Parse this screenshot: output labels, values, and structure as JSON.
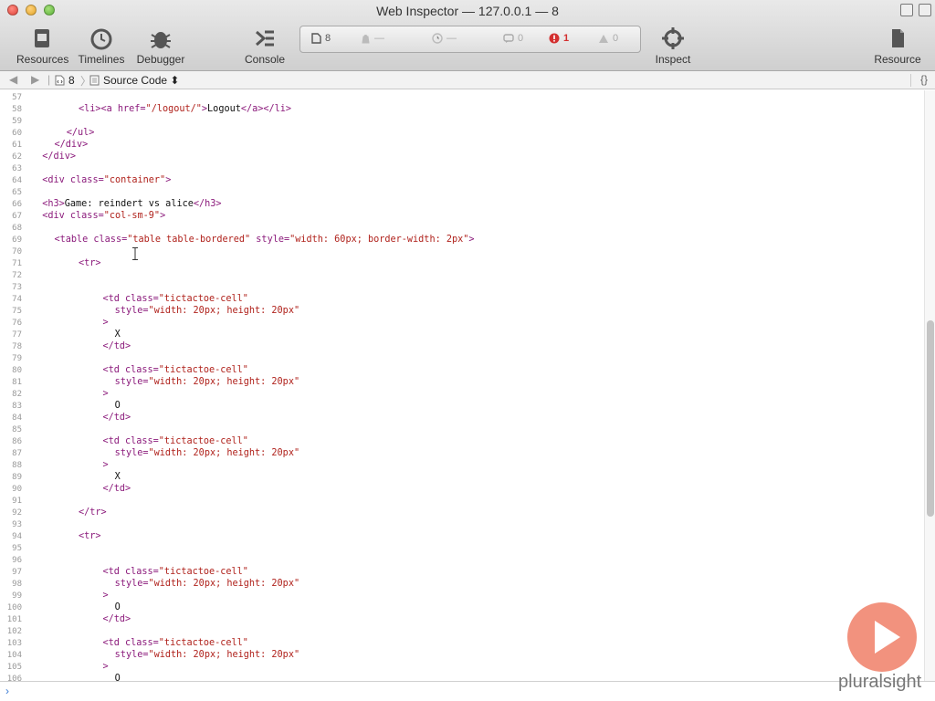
{
  "window": {
    "title": "Web Inspector — 127.0.0.1 — 8"
  },
  "toolbar": {
    "tabs": [
      {
        "label": "Resources",
        "icon": "resources-icon"
      },
      {
        "label": "Timelines",
        "icon": "timelines-icon"
      },
      {
        "label": "Debugger",
        "icon": "debugger-icon"
      },
      {
        "label": "Console",
        "icon": "console-icon"
      }
    ],
    "inspect_label": "Inspect",
    "resource_label": "Resource"
  },
  "dashboard": {
    "resources_count": "8",
    "size": "—",
    "time": "—",
    "logs": "0",
    "errors": "1",
    "warnings": "0"
  },
  "navbar": {
    "crumb_file": "8",
    "crumb_view": "Source Code ⬍",
    "pretty_print": "{}"
  },
  "source": {
    "lines": [
      {
        "n": "57",
        "i": 0,
        "t": []
      },
      {
        "n": "58",
        "i": 8,
        "t": [
          [
            "tag",
            "<li><a "
          ],
          [
            "attr",
            "href="
          ],
          [
            "val",
            "\"/logout/\""
          ],
          [
            "tag",
            ">"
          ],
          [
            "txt",
            "Logout"
          ],
          [
            "tag",
            "</a></li>"
          ]
        ]
      },
      {
        "n": "59",
        "i": 0,
        "t": []
      },
      {
        "n": "60",
        "i": 6,
        "t": [
          [
            "tag",
            "</ul>"
          ]
        ]
      },
      {
        "n": "61",
        "i": 4,
        "t": [
          [
            "tag",
            "</div>"
          ]
        ]
      },
      {
        "n": "62",
        "i": 2,
        "t": [
          [
            "tag",
            "</div>"
          ]
        ]
      },
      {
        "n": "63",
        "i": 0,
        "t": []
      },
      {
        "n": "64",
        "i": 2,
        "t": [
          [
            "tag",
            "<div "
          ],
          [
            "attr",
            "class="
          ],
          [
            "val",
            "\"container\""
          ],
          [
            "tag",
            ">"
          ]
        ]
      },
      {
        "n": "65",
        "i": 0,
        "t": []
      },
      {
        "n": "66",
        "i": 2,
        "t": [
          [
            "tag",
            "<h3>"
          ],
          [
            "txt",
            "Game: reindert vs alice"
          ],
          [
            "tag",
            "</h3>"
          ]
        ]
      },
      {
        "n": "67",
        "i": 2,
        "t": [
          [
            "tag",
            "<div "
          ],
          [
            "attr",
            "class="
          ],
          [
            "val",
            "\"col-sm-9\""
          ],
          [
            "tag",
            ">"
          ]
        ]
      },
      {
        "n": "68",
        "i": 0,
        "t": []
      },
      {
        "n": "69",
        "i": 4,
        "t": [
          [
            "tag",
            "<table "
          ],
          [
            "attr",
            "class="
          ],
          [
            "val",
            "\"table table-bordered\""
          ],
          [
            "txt",
            " "
          ],
          [
            "attr",
            "style="
          ],
          [
            "val",
            "\"width: 60px; border-width: 2px\""
          ],
          [
            "tag",
            ">"
          ]
        ]
      },
      {
        "n": "70",
        "i": 0,
        "t": []
      },
      {
        "n": "71",
        "i": 8,
        "t": [
          [
            "tag",
            "<tr>"
          ]
        ]
      },
      {
        "n": "72",
        "i": 0,
        "t": []
      },
      {
        "n": "73",
        "i": 0,
        "t": []
      },
      {
        "n": "74",
        "i": 12,
        "t": [
          [
            "tag",
            "<td "
          ],
          [
            "attr",
            "class="
          ],
          [
            "val",
            "\"tictactoe-cell\""
          ]
        ]
      },
      {
        "n": "75",
        "i": 14,
        "t": [
          [
            "attr",
            "style="
          ],
          [
            "val",
            "\"width: 20px; height: 20px\""
          ]
        ]
      },
      {
        "n": "76",
        "i": 12,
        "t": [
          [
            "tag",
            ">"
          ]
        ]
      },
      {
        "n": "77",
        "i": 14,
        "t": [
          [
            "txt",
            "X"
          ]
        ]
      },
      {
        "n": "78",
        "i": 12,
        "t": [
          [
            "tag",
            "</td>"
          ]
        ]
      },
      {
        "n": "79",
        "i": 0,
        "t": []
      },
      {
        "n": "80",
        "i": 12,
        "t": [
          [
            "tag",
            "<td "
          ],
          [
            "attr",
            "class="
          ],
          [
            "val",
            "\"tictactoe-cell\""
          ]
        ]
      },
      {
        "n": "81",
        "i": 14,
        "t": [
          [
            "attr",
            "style="
          ],
          [
            "val",
            "\"width: 20px; height: 20px\""
          ]
        ]
      },
      {
        "n": "82",
        "i": 12,
        "t": [
          [
            "tag",
            ">"
          ]
        ]
      },
      {
        "n": "83",
        "i": 14,
        "t": [
          [
            "txt",
            "O"
          ]
        ]
      },
      {
        "n": "84",
        "i": 12,
        "t": [
          [
            "tag",
            "</td>"
          ]
        ]
      },
      {
        "n": "85",
        "i": 0,
        "t": []
      },
      {
        "n": "86",
        "i": 12,
        "t": [
          [
            "tag",
            "<td "
          ],
          [
            "attr",
            "class="
          ],
          [
            "val",
            "\"tictactoe-cell\""
          ]
        ]
      },
      {
        "n": "87",
        "i": 14,
        "t": [
          [
            "attr",
            "style="
          ],
          [
            "val",
            "\"width: 20px; height: 20px\""
          ]
        ]
      },
      {
        "n": "88",
        "i": 12,
        "t": [
          [
            "tag",
            ">"
          ]
        ]
      },
      {
        "n": "89",
        "i": 14,
        "t": [
          [
            "txt",
            "X"
          ]
        ]
      },
      {
        "n": "90",
        "i": 12,
        "t": [
          [
            "tag",
            "</td>"
          ]
        ]
      },
      {
        "n": "91",
        "i": 0,
        "t": []
      },
      {
        "n": "92",
        "i": 8,
        "t": [
          [
            "tag",
            "</tr>"
          ]
        ]
      },
      {
        "n": "93",
        "i": 0,
        "t": []
      },
      {
        "n": "94",
        "i": 8,
        "t": [
          [
            "tag",
            "<tr>"
          ]
        ]
      },
      {
        "n": "95",
        "i": 0,
        "t": []
      },
      {
        "n": "96",
        "i": 0,
        "t": []
      },
      {
        "n": "97",
        "i": 12,
        "t": [
          [
            "tag",
            "<td "
          ],
          [
            "attr",
            "class="
          ],
          [
            "val",
            "\"tictactoe-cell\""
          ]
        ]
      },
      {
        "n": "98",
        "i": 14,
        "t": [
          [
            "attr",
            "style="
          ],
          [
            "val",
            "\"width: 20px; height: 20px\""
          ]
        ]
      },
      {
        "n": "99",
        "i": 12,
        "t": [
          [
            "tag",
            ">"
          ]
        ]
      },
      {
        "n": "100",
        "i": 14,
        "t": [
          [
            "txt",
            "O"
          ]
        ]
      },
      {
        "n": "101",
        "i": 12,
        "t": [
          [
            "tag",
            "</td>"
          ]
        ]
      },
      {
        "n": "102",
        "i": 0,
        "t": []
      },
      {
        "n": "103",
        "i": 12,
        "t": [
          [
            "tag",
            "<td "
          ],
          [
            "attr",
            "class="
          ],
          [
            "val",
            "\"tictactoe-cell\""
          ]
        ]
      },
      {
        "n": "104",
        "i": 14,
        "t": [
          [
            "attr",
            "style="
          ],
          [
            "val",
            "\"width: 20px; height: 20px\""
          ]
        ]
      },
      {
        "n": "105",
        "i": 12,
        "t": [
          [
            "tag",
            ">"
          ]
        ]
      },
      {
        "n": "106",
        "i": 14,
        "t": [
          [
            "txt",
            "O"
          ]
        ]
      }
    ]
  },
  "watermark": {
    "brand": "pluralsight"
  },
  "colors": {
    "tag": "#8b1a7b",
    "value": "#b0221c",
    "error": "#d32f2f",
    "accent": "#ee735a"
  }
}
